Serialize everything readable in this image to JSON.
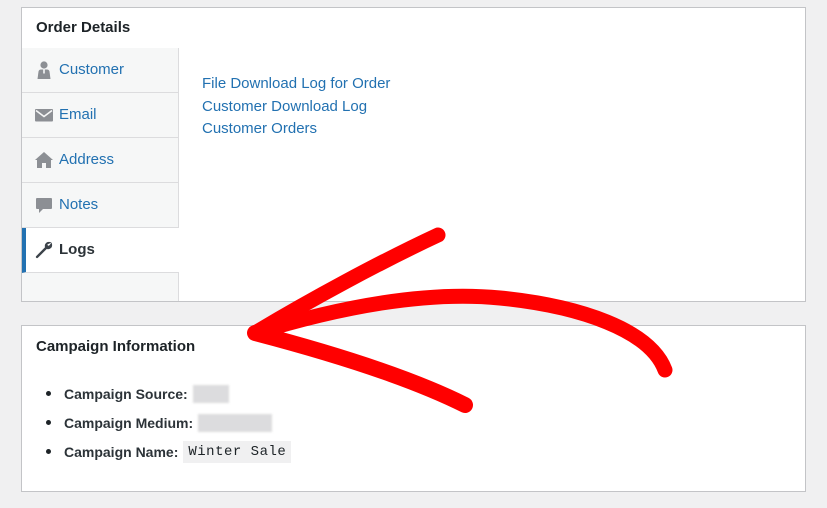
{
  "order_details": {
    "title": "Order Details",
    "tabs": [
      {
        "label": "Customer",
        "icon": "person-icon",
        "active": false
      },
      {
        "label": "Email",
        "icon": "envelope-icon",
        "active": false
      },
      {
        "label": "Address",
        "icon": "home-icon",
        "active": false
      },
      {
        "label": "Notes",
        "icon": "speech-bubble-icon",
        "active": false
      },
      {
        "label": "Logs",
        "icon": "wrench-icon",
        "active": true
      }
    ],
    "links": [
      "File Download Log for Order",
      "Customer Download Log",
      "Customer Orders"
    ]
  },
  "campaign": {
    "title": "Campaign Information",
    "items": [
      {
        "label": "Campaign Source:",
        "value": ""
      },
      {
        "label": "Campaign Medium:",
        "value": ""
      },
      {
        "label": "Campaign Name:",
        "value": "Winter Sale"
      }
    ]
  },
  "colors": {
    "link": "#2271b1",
    "active_tab_border": "#2271b1",
    "arrow": "#ff0000",
    "page_background": "#f0f0f1"
  }
}
